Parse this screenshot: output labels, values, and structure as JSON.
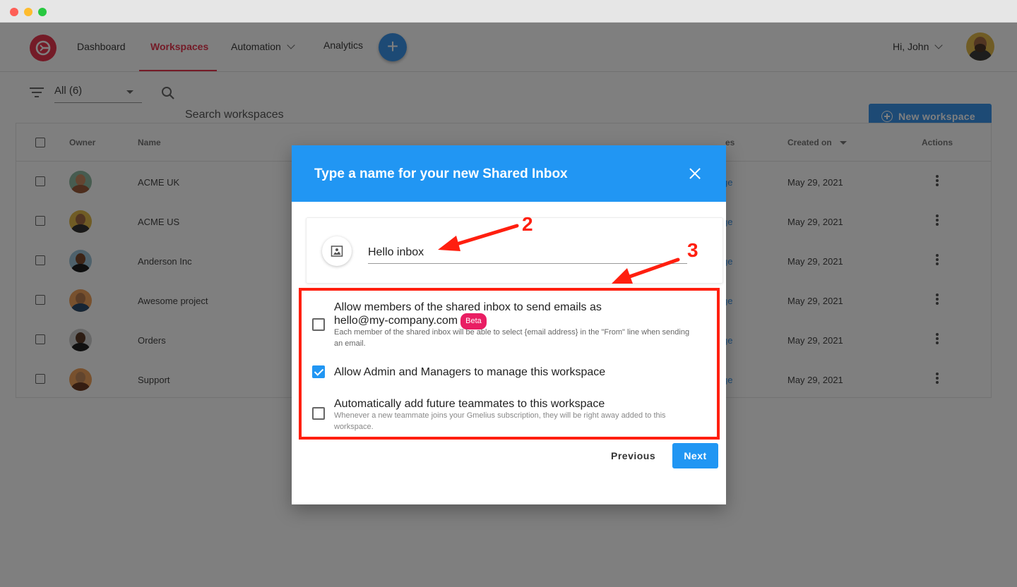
{
  "nav": {
    "items": [
      {
        "label": "Dashboard"
      },
      {
        "label": "Workspaces"
      },
      {
        "label": "Automation"
      },
      {
        "label": "Analytics"
      }
    ],
    "add_label": "+",
    "greeting": "Hi, John"
  },
  "toolbar": {
    "filter_value": "All (6)",
    "search_placeholder": "Search workspaces",
    "new_workspace_label": "New workspace"
  },
  "table": {
    "headers": {
      "owner": "Owner",
      "name": "Name",
      "col_partial": "es",
      "created_on": "Created on",
      "actions": "Actions"
    },
    "rows": [
      {
        "name": "ACME UK",
        "link": "ge",
        "created": "May 29, 2021"
      },
      {
        "name": "ACME US",
        "link": "ge",
        "created": "May 29, 2021"
      },
      {
        "name": "Anderson Inc",
        "link": "ge",
        "created": "May 29, 2021"
      },
      {
        "name": "Awesome project",
        "link": "ge",
        "created": "May 29, 2021"
      },
      {
        "name": "Orders",
        "link": "ge",
        "created": "May 29, 2021"
      },
      {
        "name": "Support",
        "link": "ge",
        "created": "May 29, 2021"
      }
    ]
  },
  "modal": {
    "title": "Type a name for your new Shared Inbox",
    "inbox_name": "Hello inbox",
    "options": [
      {
        "label_line1": "Allow members of the shared inbox to send emails as",
        "label_line2": "hello@my-company.com",
        "badge": "Beta",
        "description": "Each member of the shared inbox will be able to select {email address} in the \"From\" line when sending an email.",
        "checked": false
      },
      {
        "label": "Allow Admin and Managers to manage this workspace",
        "checked": true
      },
      {
        "label": "Automatically add future teammates to this workspace",
        "description": "Whenever a new teammate joins your Gmelius subscription, they will be right away added to this workspace.",
        "checked": false
      }
    ],
    "previous_label": "Previous",
    "next_label": "Next"
  },
  "annotations": {
    "step_a": "2",
    "step_b": "3",
    "color": "#ff1f0f"
  },
  "colors": {
    "brand": "#e8364f",
    "primary": "#2196f3"
  }
}
